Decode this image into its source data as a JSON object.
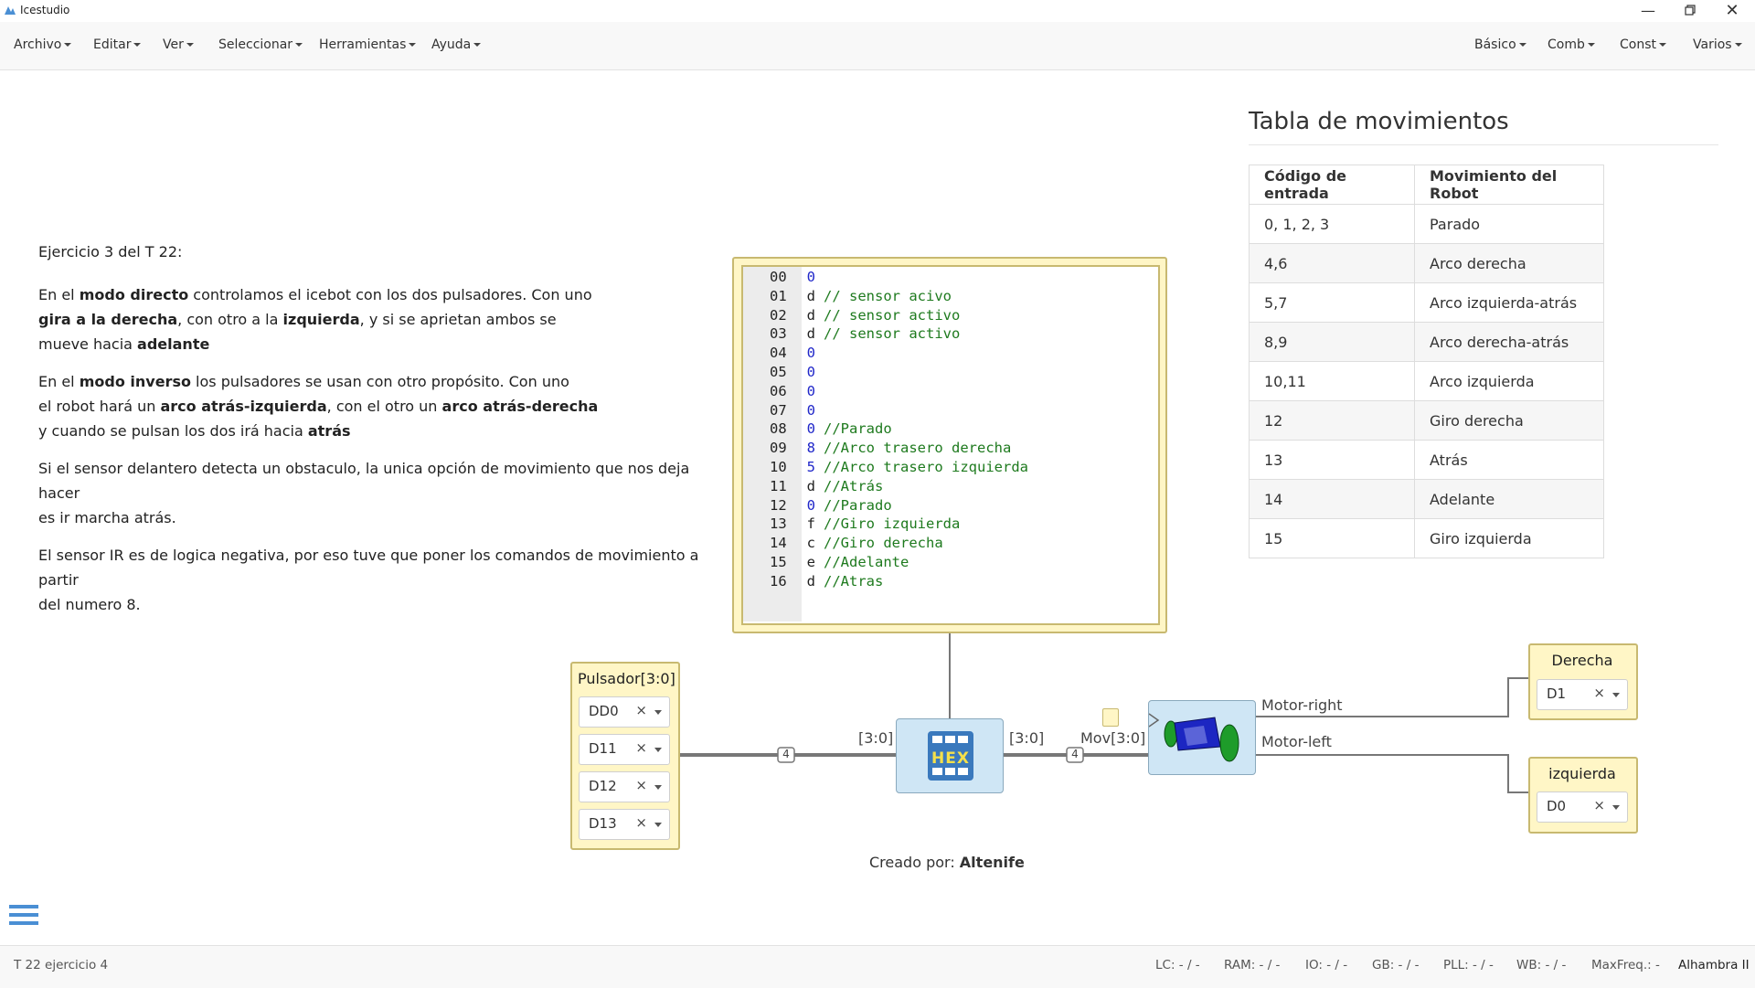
{
  "window": {
    "title": "Icestudio"
  },
  "menubar": {
    "left": [
      {
        "label": "Archivo"
      },
      {
        "label": "Editar"
      },
      {
        "label": "Ver"
      },
      {
        "label": "Seleccionar"
      },
      {
        "label": "Herramientas"
      },
      {
        "label": "Ayuda"
      }
    ],
    "right": [
      {
        "label": "Básico"
      },
      {
        "label": "Comb"
      },
      {
        "label": "Const"
      },
      {
        "label": "Varios"
      }
    ]
  },
  "description": {
    "heading": "Ejercicio 3 del T 22:",
    "p1": {
      "t1": "En el ",
      "b1": "modo directo",
      "t2": " controlamos el icebot con los dos pulsadores. Con uno",
      "b2": "gira a la derecha",
      "t3": ", con otro a la ",
      "b3": "izquierda",
      "t4": ", y si se aprietan ambos se",
      "t5": "mueve hacia ",
      "b4": "adelante"
    },
    "p2": {
      "t1": "En el ",
      "b1": "modo inverso",
      "t2": " los pulsadores se usan con otro propósito. Con uno",
      "t3": "el robot hará un ",
      "b2": "arco atrás-izquierda",
      "t4": ", con el otro un ",
      "b3": "arco atrás-derecha",
      "t5": "y cuando se pulsan los dos irá hacia ",
      "b4": "atrás"
    },
    "p3": {
      "l1": "Si el sensor delantero detecta un obstaculo, la unica opción de movimiento que nos deja hacer",
      "l2": "es ir marcha atrás."
    },
    "p4": {
      "l1": "El sensor IR es de logica negativa, por eso tuve que poner los comandos de movimiento a partir",
      "l2": "del numero 8."
    }
  },
  "table": {
    "title": "Tabla de movimientos",
    "headers": [
      "Código de entrada",
      "Movimiento del Robot"
    ],
    "rows": [
      [
        "0, 1, 2, 3",
        "Parado"
      ],
      [
        "4,6",
        "Arco derecha"
      ],
      [
        "5,7",
        "Arco izquierda-atrás"
      ],
      [
        "8,9",
        "Arco derecha-atrás"
      ],
      [
        "10,11",
        "Arco izquierda"
      ],
      [
        "12",
        "Giro derecha"
      ],
      [
        "13",
        "Atrás"
      ],
      [
        "14",
        "Adelante"
      ],
      [
        "15",
        "Giro izquierda"
      ]
    ]
  },
  "memory": {
    "lines": [
      {
        "n": "00",
        "v": "0",
        "c": ""
      },
      {
        "n": "01",
        "v": "d",
        "c": "// sensor acivo"
      },
      {
        "n": "02",
        "v": "d",
        "c": "// sensor activo"
      },
      {
        "n": "03",
        "v": "d",
        "c": "// sensor activo"
      },
      {
        "n": "04",
        "v": "0",
        "c": ""
      },
      {
        "n": "05",
        "v": "0",
        "c": ""
      },
      {
        "n": "06",
        "v": "0",
        "c": ""
      },
      {
        "n": "07",
        "v": "0",
        "c": ""
      },
      {
        "n": "08",
        "v": "0",
        "c": "//Parado"
      },
      {
        "n": "09",
        "v": "8",
        "c": "//Arco trasero derecha"
      },
      {
        "n": "10",
        "v": "5",
        "c": "//Arco trasero izquierda"
      },
      {
        "n": "11",
        "v": "d",
        "c": "//Atrás"
      },
      {
        "n": "12",
        "v": "0",
        "c": "//Parado"
      },
      {
        "n": "13",
        "v": "f",
        "c": "//Giro izquierda"
      },
      {
        "n": "14",
        "v": "c",
        "c": "//Giro derecha"
      },
      {
        "n": "15",
        "v": "e",
        "c": "//Adelante"
      },
      {
        "n": "16",
        "v": "d",
        "c": "//Atras"
      }
    ]
  },
  "circuit": {
    "input_block": {
      "title": "Pulsador[3:0]",
      "pins": [
        "DD0",
        "D11",
        "D12",
        "D13"
      ]
    },
    "hex_label": "HEX",
    "bus_in_label": "[3:0]",
    "bus_out_label": "[3:0]",
    "bus_width_1": "4",
    "bus_width_2": "4",
    "motor_in_label": "Mov[3:0]",
    "motor_right_label": "Motor-right",
    "motor_left_label": "Motor-left",
    "out_right": {
      "title": "Derecha",
      "pin": "D1"
    },
    "out_left": {
      "title": "izquierda",
      "pin": "D0"
    },
    "credit_prefix": "Creado por: ",
    "credit_name": "Altenife"
  },
  "status": {
    "project": "T 22 ejercicio 4",
    "lc": "LC:  - / -",
    "ram": "RAM:  - / -",
    "io": "IO:  - / -",
    "gb": "GB:  - / -",
    "pll": "PLL:  - / -",
    "wb": "WB:  - / -",
    "maxfreq": "MaxFreq.:  -",
    "board": "Alhambra II"
  },
  "colors": {
    "accent": "#4a8fd4",
    "block_yellow": "#fff6c6",
    "block_blue": "#cfe6f5",
    "code_value": "#1f26c9",
    "code_comment": "#1e7a1e"
  }
}
